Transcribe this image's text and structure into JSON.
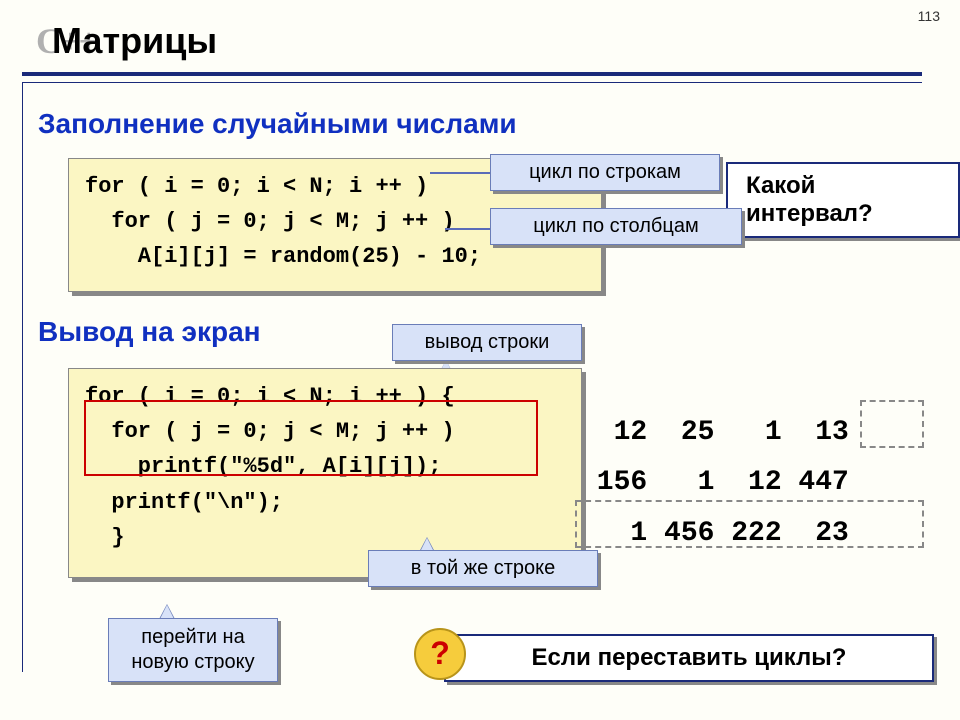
{
  "page_number": "113",
  "logo": "C++",
  "title": "Матрицы",
  "section1": {
    "heading": "Заполнение случайными числами",
    "code": "for ( i = 0; i < N; i ++ )\n  for ( j = 0; j < M; j ++ )\n    A[i][j] = random(25) - 10;"
  },
  "callouts": {
    "rows_loop": "цикл по строкам",
    "cols_loop": "цикл по столбцам",
    "line_output": "вывод строки",
    "same_line": "в той же строке",
    "new_line": "перейти на\nновую строку"
  },
  "question1": "Какой интервал?",
  "section2": {
    "heading": "Вывод на экран",
    "code": "for ( i = 0; i < N; i ++ ) {\n  for ( j = 0; j < M; j ++ )\n    printf(\"%5d\", A[i][j]);\n  printf(\"\\n\");\n  }"
  },
  "output": "  12  25   1  13\n 156   1  12 447\n   1 456 222  23",
  "question2": "Если переставить циклы?",
  "qmark": "?"
}
